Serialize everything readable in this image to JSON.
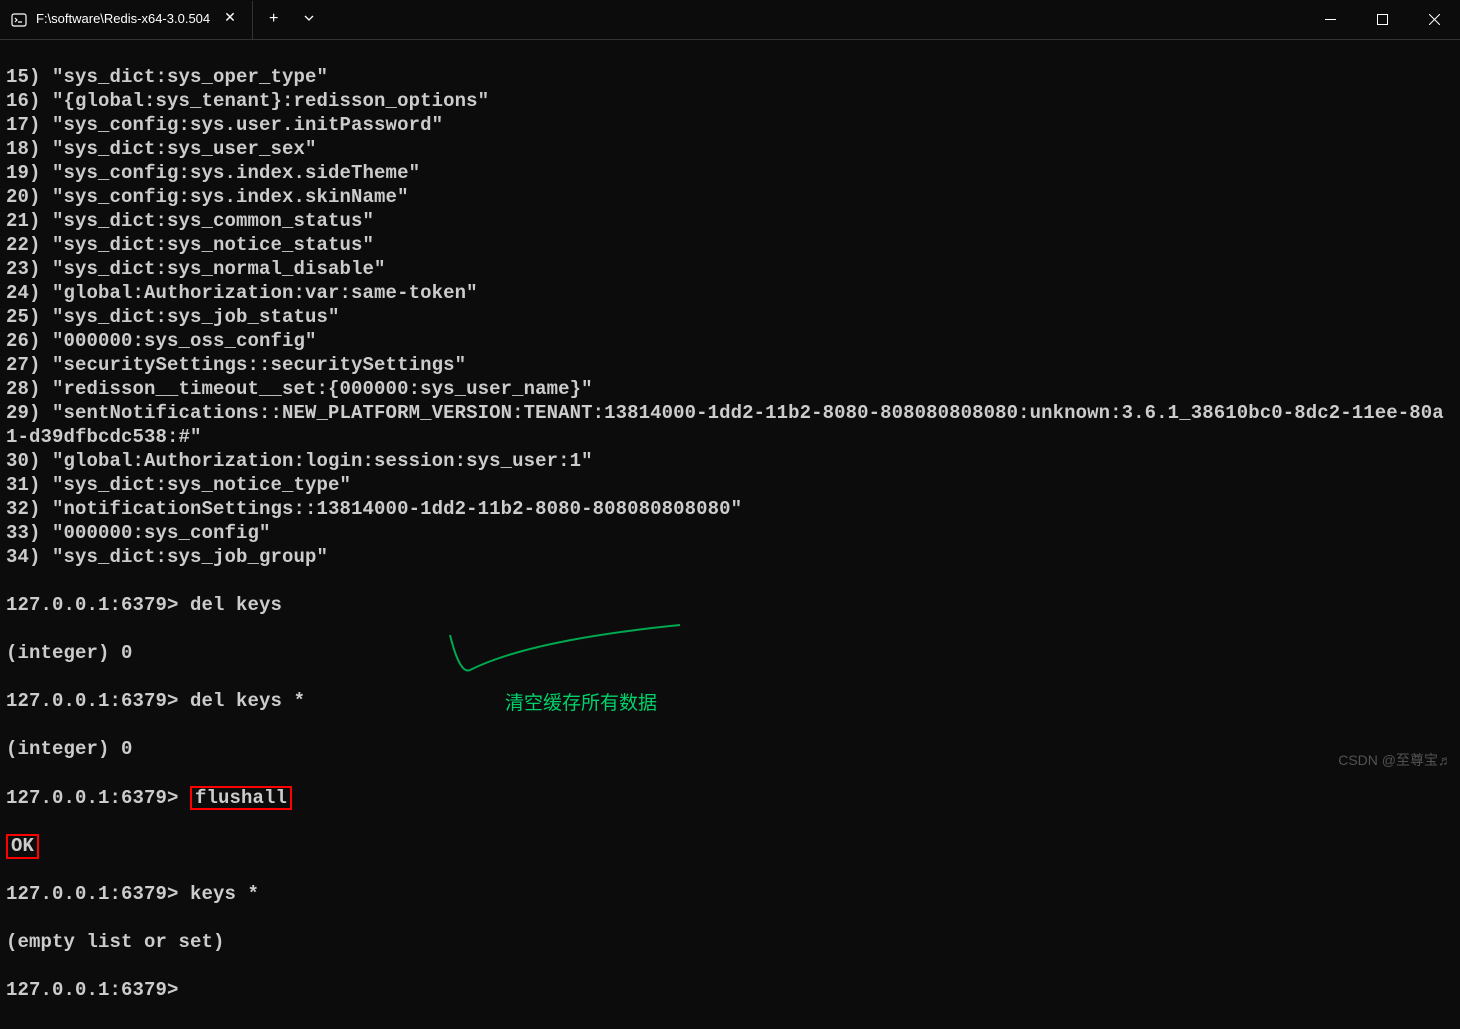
{
  "titlebar": {
    "tab_title": "F:\\software\\Redis-x64-3.0.504"
  },
  "terminal": {
    "keys": [
      {
        "num": "15)",
        "val": "\"sys_dict:sys_oper_type\""
      },
      {
        "num": "16)",
        "val": "\"{global:sys_tenant}:redisson_options\""
      },
      {
        "num": "17)",
        "val": "\"sys_config:sys.user.initPassword\""
      },
      {
        "num": "18)",
        "val": "\"sys_dict:sys_user_sex\""
      },
      {
        "num": "19)",
        "val": "\"sys_config:sys.index.sideTheme\""
      },
      {
        "num": "20)",
        "val": "\"sys_config:sys.index.skinName\""
      },
      {
        "num": "21)",
        "val": "\"sys_dict:sys_common_status\""
      },
      {
        "num": "22)",
        "val": "\"sys_dict:sys_notice_status\""
      },
      {
        "num": "23)",
        "val": "\"sys_dict:sys_normal_disable\""
      },
      {
        "num": "24)",
        "val": "\"global:Authorization:var:same-token\""
      },
      {
        "num": "25)",
        "val": "\"sys_dict:sys_job_status\""
      },
      {
        "num": "26)",
        "val": "\"000000:sys_oss_config\""
      },
      {
        "num": "27)",
        "val": "\"securitySettings::securitySettings\""
      },
      {
        "num": "28)",
        "val": "\"redisson__timeout__set:{000000:sys_user_name}\""
      },
      {
        "num": "29)",
        "val": "\"sentNotifications::NEW_PLATFORM_VERSION:TENANT:13814000-1dd2-11b2-8080-808080808080:unknown:3.6.1_38610bc0-8dc2-11ee-80a1-d39dfbcdc538:#\""
      },
      {
        "num": "30)",
        "val": "\"global:Authorization:login:session:sys_user:1\""
      },
      {
        "num": "31)",
        "val": "\"sys_dict:sys_notice_type\""
      },
      {
        "num": "32)",
        "val": "\"notificationSettings::13814000-1dd2-11b2-8080-808080808080\""
      },
      {
        "num": "33)",
        "val": "\"000000:sys_config\""
      },
      {
        "num": "34)",
        "val": "\"sys_dict:sys_job_group\""
      }
    ],
    "prompt": "127.0.0.1:6379>",
    "cmd_del_keys": "del keys",
    "result_int0": "(integer) 0",
    "cmd_del_keys_star": "del keys *",
    "cmd_flushall": "flushall",
    "result_ok": "OK",
    "cmd_keys_star": "keys *",
    "result_empty": "(empty list or set)"
  },
  "annotation": {
    "text": "清空缓存所有数据"
  },
  "watermark": {
    "text": "CSDN @至尊宝♬"
  }
}
